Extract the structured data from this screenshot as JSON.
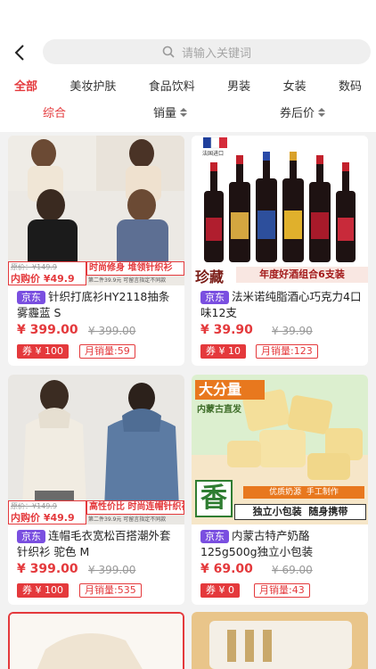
{
  "search": {
    "placeholder": "请输入关键词"
  },
  "categories": [
    "全部",
    "美妆护肤",
    "食品饮料",
    "男装",
    "女装",
    "数码"
  ],
  "sorts": [
    "综合",
    "销量",
    "券后价"
  ],
  "products": [
    {
      "image_banner": "时尚修身 堆领针织衫",
      "image_promo_old": "原价：¥149.9",
      "image_promo_price": "内购价 ¥49.9",
      "image_promo_note": "第二件39.9元  可留言指定不同款",
      "platform": "京东",
      "title": "针织打底衫HY2118抽条雾霾蓝 S",
      "price": "¥ 399.00",
      "original_price": "¥ 399.00",
      "coupon": "券 ¥ 100",
      "sales": "月销量:59"
    },
    {
      "image_badge": "法国进口",
      "image_banner_left": "珍藏",
      "image_banner": "年度好酒组合6支装",
      "platform": "京东",
      "title": "法米诺纯脂酒心巧克力4口味12支",
      "price": "¥ 39.90",
      "original_price": "¥ 39.90",
      "coupon": "券 ¥ 10",
      "sales": "月销量:123"
    },
    {
      "image_banner": "高性价比 时尚连帽针织衫",
      "image_promo_old": "原价：¥149.9",
      "image_promo_price": "内购价 ¥49.9",
      "image_promo_note": "第二件39.9元  可留言指定不同款",
      "platform": "京东",
      "title": "连帽毛衣宽松百搭潮外套针织衫 驼色 M",
      "price": "¥ 399.00",
      "original_price": "¥ 399.00",
      "coupon": "券 ¥ 100",
      "sales": "月销量:535"
    },
    {
      "image_tag_big": "大分量",
      "image_tag_sub": "内蒙古直发",
      "image_big_char": "香",
      "image_feature_1": "优质奶源  手工制作",
      "image_feature_2": "独立小包装  随身携带",
      "platform": "京东",
      "title": "内蒙古特产奶酪125g500g独立小包装",
      "price": "¥ 69.00",
      "original_price": "¥ 69.00",
      "coupon": "券 ¥ 0",
      "sales": "月销量:43"
    }
  ],
  "colors": {
    "accent": "#e4393c",
    "platform_badge": "#7a4fe0"
  }
}
